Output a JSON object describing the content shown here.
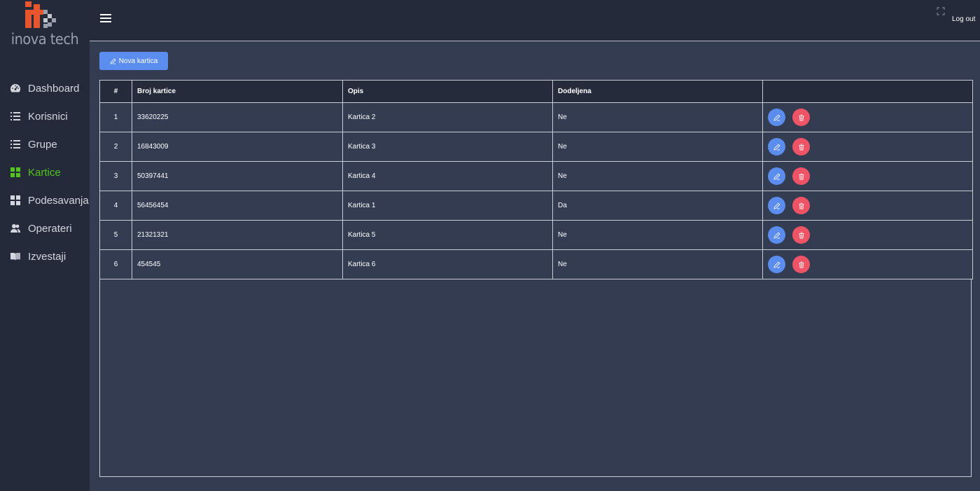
{
  "brand": {
    "logo_text": "inova tech",
    "colors": {
      "accent_orange": "#e8562e",
      "grey": "#9aa0ad"
    }
  },
  "sidebar": {
    "items": [
      {
        "label": "Dashboard",
        "icon": "dashboard-icon",
        "active": false
      },
      {
        "label": "Korisnici",
        "icon": "list-icon",
        "active": false
      },
      {
        "label": "Grupe",
        "icon": "list-icon",
        "active": false
      },
      {
        "label": "Kartice",
        "icon": "grid-icon",
        "active": true
      },
      {
        "label": "Podesavanja",
        "icon": "grid-icon",
        "active": false
      },
      {
        "label": "Operateri",
        "icon": "users-icon",
        "active": false
      },
      {
        "label": "Izvestaji",
        "icon": "book-icon",
        "active": false
      }
    ]
  },
  "topbar": {
    "logout_label": "Log out"
  },
  "toolbar": {
    "new_card_label": "Nova kartica"
  },
  "table": {
    "headers": [
      "#",
      "Broj kartice",
      "Opis",
      "Dodeljena",
      ""
    ],
    "rows": [
      [
        "1",
        "33620225",
        "Kartica 2",
        "Ne"
      ],
      [
        "2",
        "16843009",
        "Kartica 3",
        "Ne"
      ],
      [
        "3",
        "50397441",
        "Kartica 4",
        "Ne"
      ],
      [
        "4",
        "56456454",
        "Kartica 1",
        "Da"
      ],
      [
        "5",
        "21321321",
        "Kartica 5",
        "Ne"
      ],
      [
        "6",
        "454545",
        "Kartica 6",
        "Ne"
      ]
    ]
  },
  "colors": {
    "sidebar_bg": "#252a3b",
    "content_bg": "#343c52",
    "active_green": "#52c41a",
    "edit_blue": "#5b8def",
    "delete_red": "#ee5366"
  }
}
